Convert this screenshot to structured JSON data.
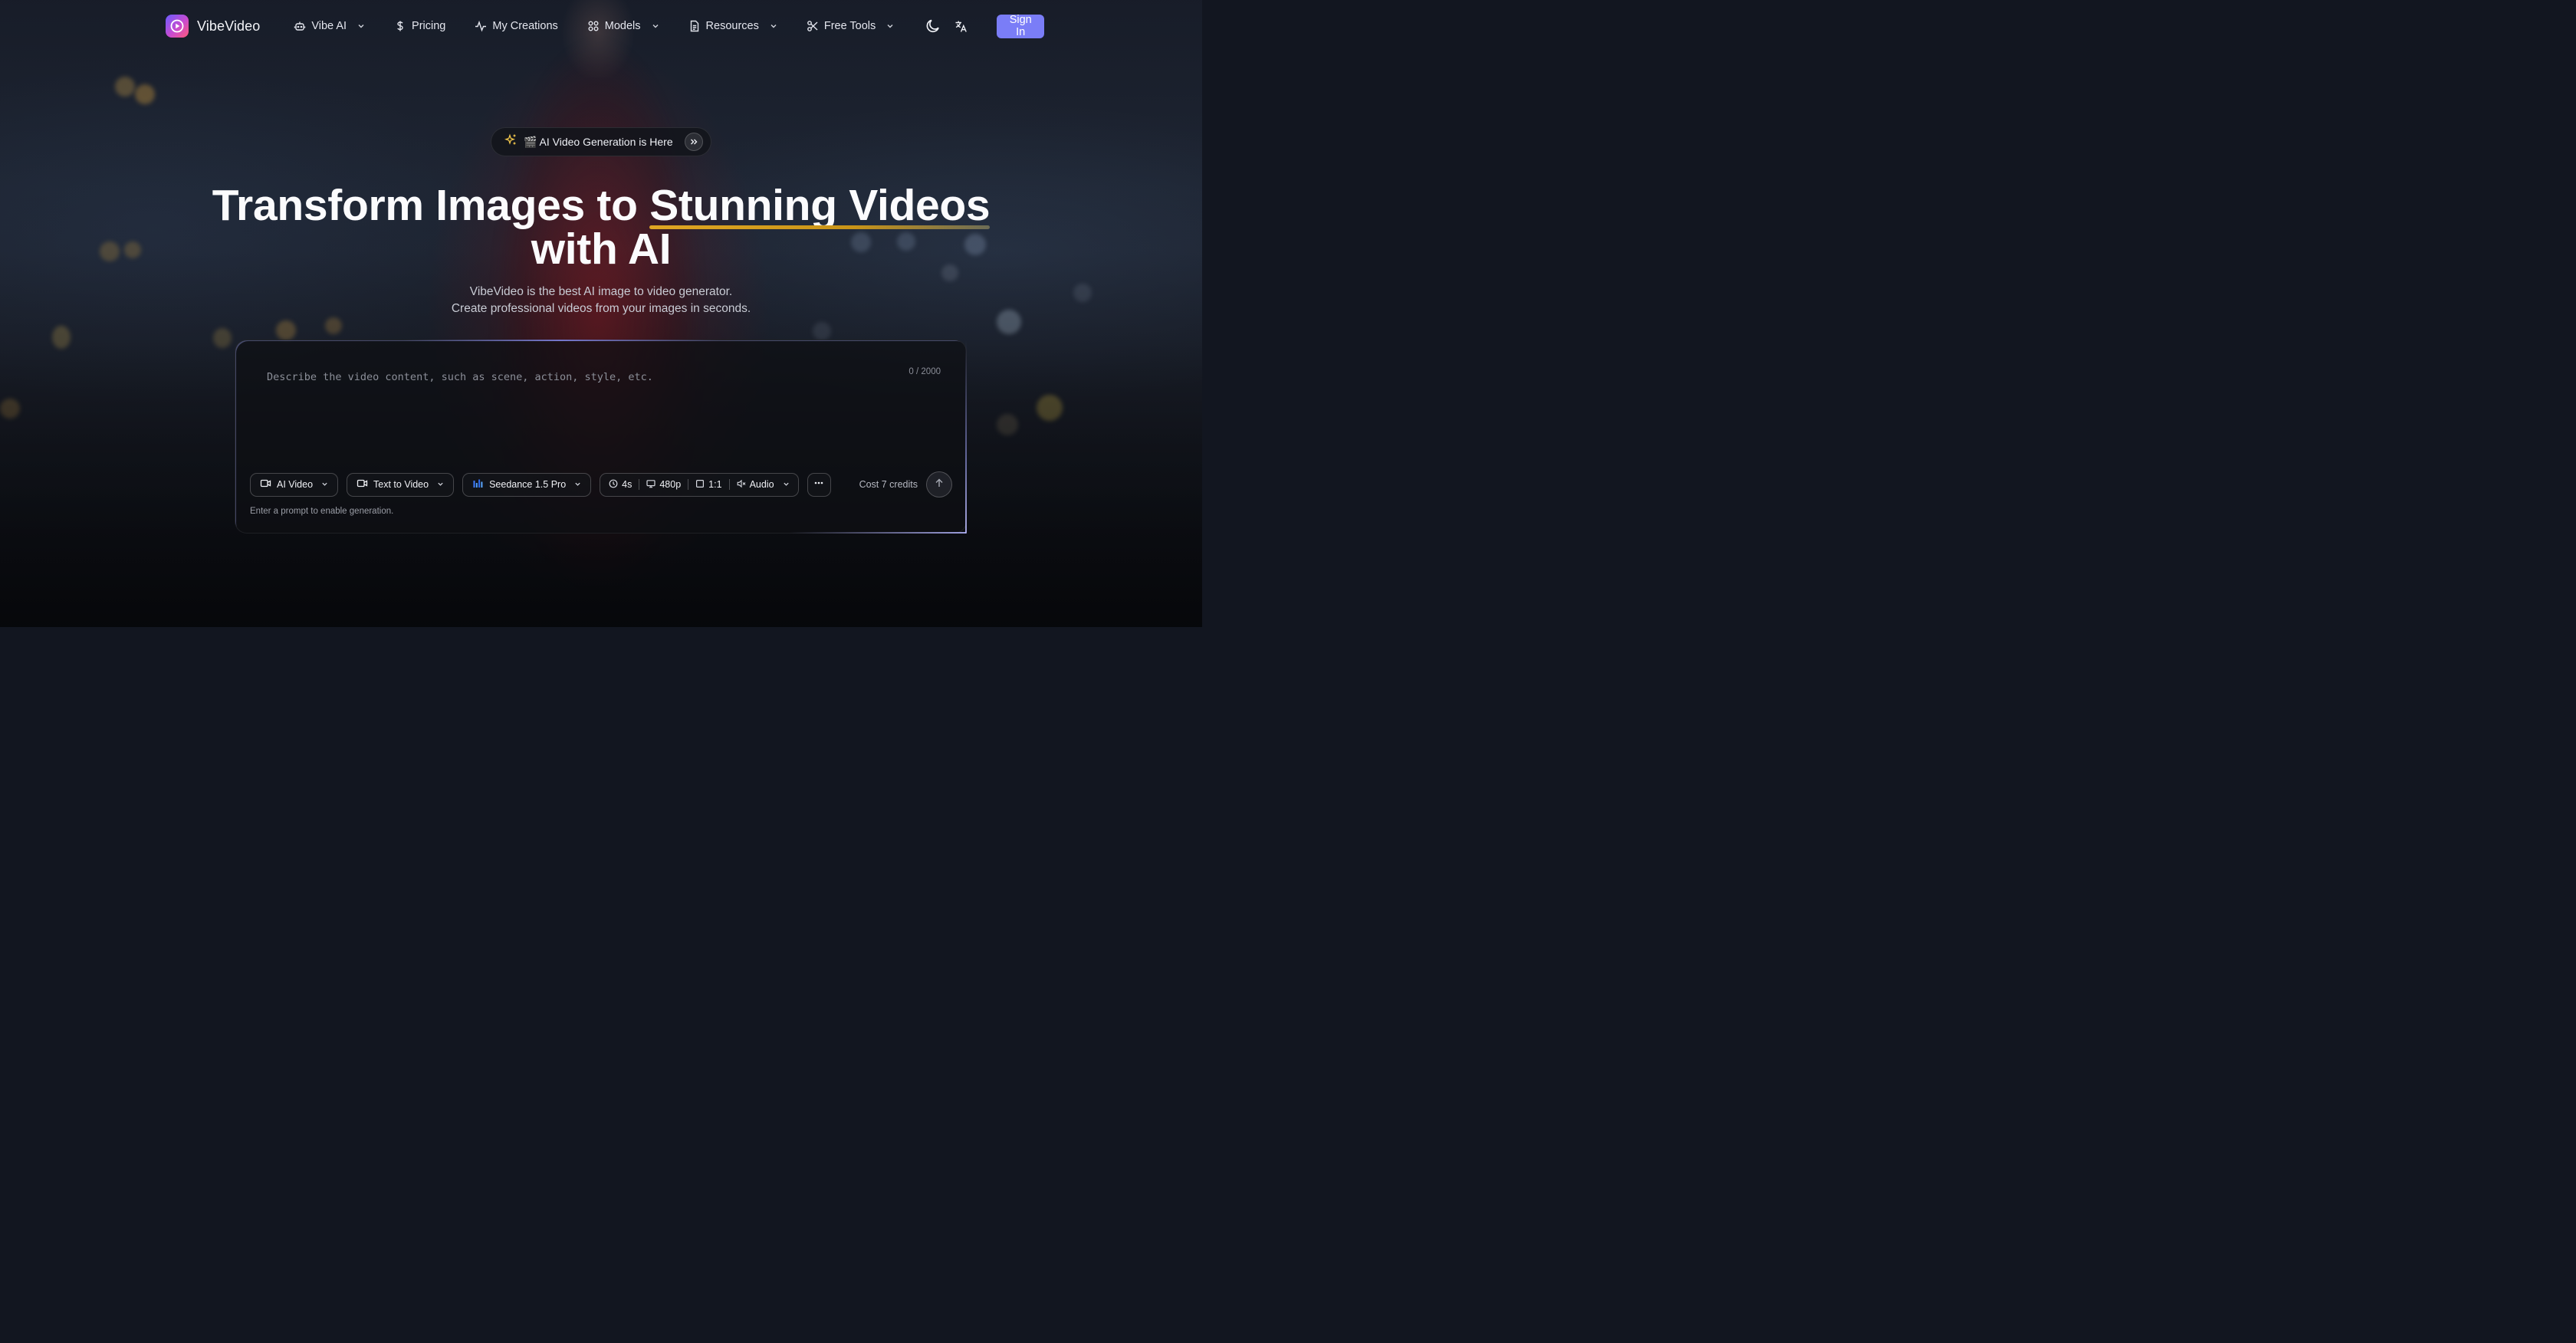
{
  "brand": {
    "name": "VibeVideo",
    "logo_icon": "play-circle-icon"
  },
  "nav": {
    "items": [
      {
        "label": "Vibe AI",
        "icon": "bot-icon",
        "has_dropdown": true
      },
      {
        "label": "Pricing",
        "icon": "dollar-icon",
        "has_dropdown": false
      },
      {
        "label": "My Creations",
        "icon": "activity-icon",
        "has_dropdown": false
      },
      {
        "label": "Models",
        "icon": "grid-icon",
        "has_dropdown": true
      },
      {
        "label": "Resources",
        "icon": "document-icon",
        "has_dropdown": true
      },
      {
        "label": "Free Tools",
        "icon": "scissors-icon",
        "has_dropdown": true
      }
    ],
    "theme_toggle_icon": "moon-icon",
    "language_icon": "translate-icon",
    "sign_in": "Sign In"
  },
  "hero": {
    "badge": "🎬 AI Video Generation is Here",
    "headline_part1": "Transform Images to ",
    "headline_highlight": "Stunning Videos",
    "headline_part2": "with AI",
    "subtitle_line1": "VibeVideo is the best AI image to video generator.",
    "subtitle_line2": "Create professional videos from your images in seconds."
  },
  "prompt_card": {
    "placeholder": "Describe the video content, such as scene, action, style, etc.",
    "value": "",
    "counter": "0 / 2000",
    "mode": "AI Video",
    "generation_type": "Text to Video",
    "model": "Seedance 1.5 Pro",
    "duration": "4s",
    "resolution": "480p",
    "aspect_ratio": "1:1",
    "audio": "Audio",
    "cost": "Cost 7 credits",
    "hint": "Enter a prompt to enable generation."
  },
  "colors": {
    "accent": "#7a7df7",
    "highlight_underline": "#e0a623",
    "background": "#121620"
  }
}
